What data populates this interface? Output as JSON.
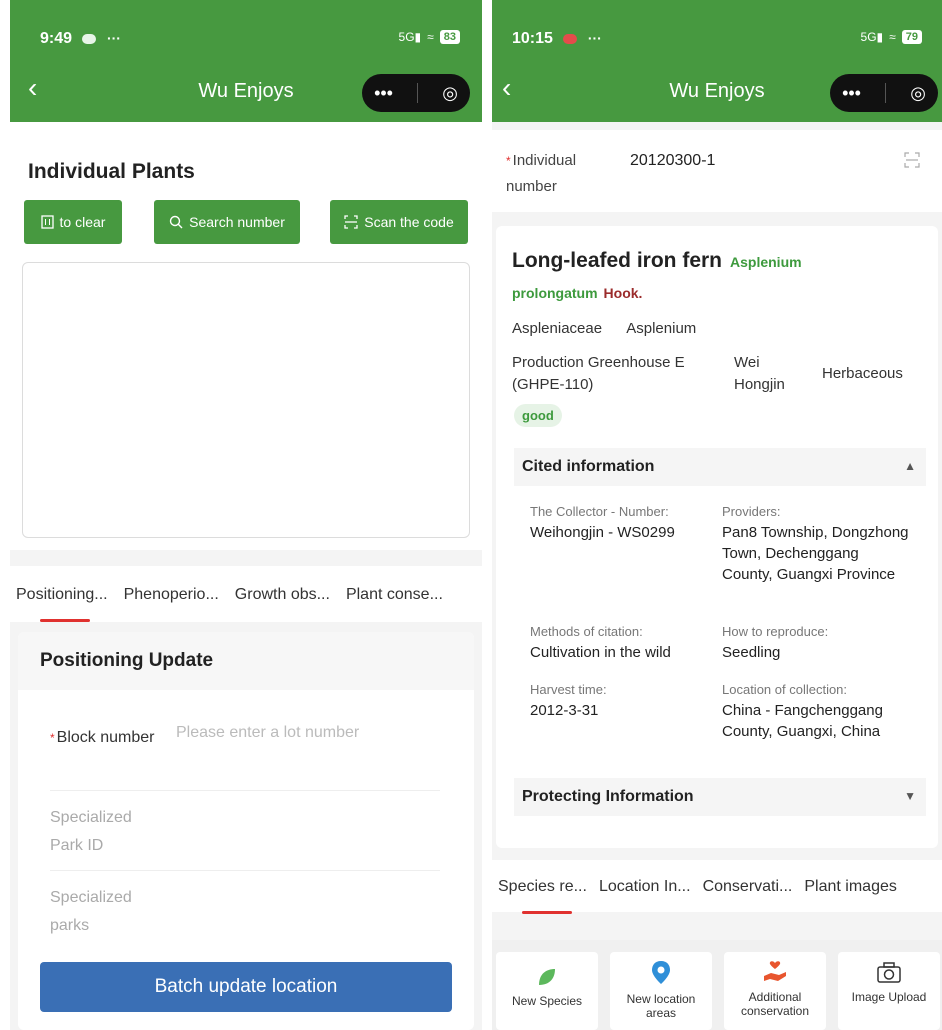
{
  "left": {
    "status": {
      "time": "9:49",
      "dots": "···",
      "signal": "5G",
      "battery": "83"
    },
    "nav": {
      "title": "Wu Enjoys",
      "more": "•••",
      "record": "◎"
    },
    "section_title": "Individual Plants",
    "buttons": {
      "clear": "to clear",
      "search": "Search number",
      "scan": "Scan the code"
    },
    "tabs": [
      "Positioning...",
      "Phenoperio...",
      "Growth obs...",
      "Plant conse..."
    ],
    "form": {
      "title": "Positioning Update",
      "block_label": "Block number",
      "block_placeholder": "Please enter a lot number",
      "park_id_label": "Specialized Park ID",
      "parks_label": "Specialized parks",
      "submit": "Batch update location"
    }
  },
  "right": {
    "status": {
      "time": "10:15",
      "dots": "···",
      "signal": "5G",
      "battery": "79"
    },
    "nav": {
      "title": "Wu Enjoys",
      "more": "•••",
      "record": "◎"
    },
    "individual": {
      "label": "Individual number",
      "value": "20120300-1"
    },
    "species": {
      "common_name": "Long-leafed iron fern",
      "latin_name": "Asplenium prolongatum",
      "author": "Hook.",
      "family": "Aspleniaceae",
      "genus": "Asplenium",
      "location": "Production Greenhouse E (GHPE-110)",
      "person": "Wei Hongjin",
      "habit": "Herbaceous",
      "status": "good"
    },
    "cited": {
      "title": "Cited information",
      "collector_label": "The Collector - Number:",
      "collector_value": "Weihongjin - WS0299",
      "providers_label": "Providers:",
      "providers_value": "Pan8 Township, Dongzhong Town, Dechenggang County, Guangxi Province",
      "method_label": "Methods of citation:",
      "method_value": "Cultivation in the wild",
      "reproduce_label": "How to reproduce:",
      "reproduce_value": "Seedling",
      "harvest_label": "Harvest time:",
      "harvest_value": "2012-3-31",
      "collection_label": "Location of collection:",
      "collection_value": "China - Fangchenggang County, Guangxi, China"
    },
    "protecting": {
      "title": "Protecting Information"
    },
    "tabs": [
      "Species re...",
      "Location In...",
      "Conservati...",
      "Plant images"
    ],
    "bottom": [
      "New Species",
      "New location areas",
      "Additional conservation",
      "Image Upload"
    ]
  },
  "colors": {
    "header_green": "#479940",
    "primary_blue": "#3a6fb5",
    "accent_red": "#e0312f",
    "latin_green": "#3d9a3d",
    "author_red": "#9b2b2b"
  }
}
